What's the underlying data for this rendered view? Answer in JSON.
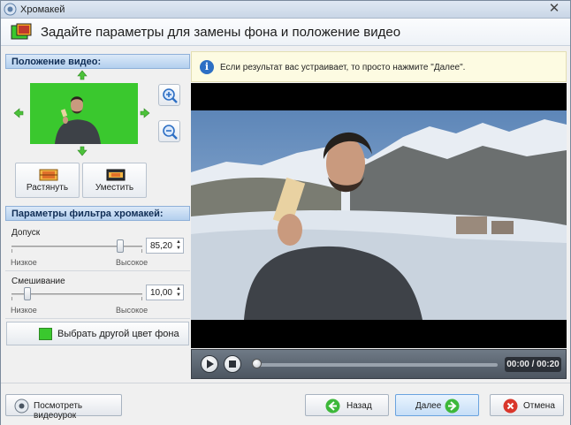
{
  "window": {
    "title": "Хромакей"
  },
  "header": {
    "title": "Задайте параметры для замены фона и положение видео"
  },
  "video_position": {
    "section_title": "Положение видео:",
    "stretch_label": "Растянуть",
    "fit_label": "Уместить"
  },
  "filter": {
    "section_title": "Параметры фильтра хромакей:",
    "tolerance": {
      "label": "Допуск",
      "value": "85,20",
      "low": "Низкое",
      "high": "Высокое",
      "level": 0.85
    },
    "blend": {
      "label": "Смешивание",
      "value": "10,00",
      "low": "Низкое",
      "high": "Высокое",
      "level": 0.1
    },
    "color_button_label": "Выбрать другой цвет фона",
    "key_color": "#3ac82e"
  },
  "info": {
    "text": "Если результат вас устраивает, то просто нажмите \"Далее\"."
  },
  "player": {
    "time": "00:00 / 00:20",
    "progress": 0
  },
  "footer": {
    "tutorial_label": "Посмотреть видеоурок",
    "back_label": "Назад",
    "next_label": "Далее",
    "cancel_label": "Отмена"
  }
}
